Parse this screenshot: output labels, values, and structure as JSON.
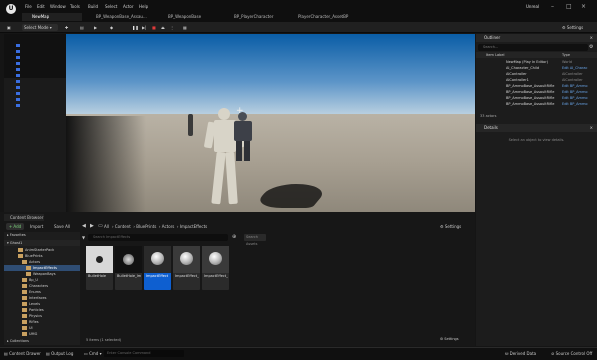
{
  "app": {
    "map_tab": "NewMap",
    "window_title": "Unreal"
  },
  "menu": [
    "File",
    "Edit",
    "Window",
    "Tools",
    "Build",
    "Select",
    "Actor",
    "Help"
  ],
  "tabs": [
    "BP_WeaponBase_Assau...",
    "BP_WeaponBase",
    "BP_PlayerCharacter",
    "PlayerCharacter_AssetBP"
  ],
  "toolbar": {
    "save_label": "",
    "mode_label": "Select Mode",
    "settings_label": "Settings"
  },
  "outliner": {
    "title": "Outliner",
    "search_placeholder": "Search...",
    "col_item": "Item Label",
    "col_type": "Type",
    "rows": [
      {
        "name": "NewMap (Play In Editor)",
        "type": "World",
        "grey": true
      },
      {
        "name": "AI_Character_Child",
        "type": "Edit AI_Charac",
        "grey": false
      },
      {
        "name": "AIController",
        "type": "AIController",
        "grey": true
      },
      {
        "name": "AIController1",
        "type": "AIController",
        "grey": true
      },
      {
        "name": "BP_AmmoBase_AssaultRifle",
        "type": "Edit BP_Ammo",
        "grey": false
      },
      {
        "name": "BP_AmmoBase_AssaultRifle",
        "type": "Edit BP_Ammo",
        "grey": false
      },
      {
        "name": "BP_AmmoBase_AssaultRifle",
        "type": "Edit BP_Ammo",
        "grey": false
      },
      {
        "name": "BP_AmmoBase_AssaultRifle",
        "type": "Edit BP_Ammo",
        "grey": false
      }
    ],
    "count": "33 actors"
  },
  "details": {
    "title": "Details",
    "empty_text": "Select an object to view details."
  },
  "content_browser": {
    "title": "Content Browser",
    "add_label": "+ Add",
    "import_label": "Import",
    "save_all_label": "Save All",
    "all_label": "All",
    "breadcrumb": [
      "Content",
      "BluePrints",
      "Actors",
      "ImpactEffects"
    ],
    "settings_label": "Settings",
    "search_placeholder": "Search ImpactEffects",
    "search_assets_placeholder": "Search Assets",
    "favorites_label": "Favorites",
    "project_label": "Ghost1",
    "collections_label": "Collections",
    "items_count": "5 items (1 selected)",
    "folders": [
      "AnimStarterPack",
      "BluePrints",
      "Actors",
      "ImpactEffects",
      "WeaponBays",
      "Bp_U",
      "Characters",
      "Enums",
      "Interfaces",
      "Levels",
      "Particles",
      "Physics",
      "Rifles",
      "UI",
      "UMG",
      "Weapons",
      "Meshs"
    ],
    "assets": [
      {
        "name": "BulletHole",
        "sub": ""
      },
      {
        "name": "BulletHole_Image",
        "sub": ""
      },
      {
        "name": "ImpactEffect",
        "sub": ""
      },
      {
        "name": "ImpactEffect_AssaultRifle",
        "sub": ""
      },
      {
        "name": "ImpactEffect_Pistol",
        "sub": ""
      }
    ]
  },
  "status": {
    "content_drawer": "Content Drawer",
    "output_log": "Output Log",
    "cmd": "Cmd",
    "console_placeholder": "Enter Console Command",
    "derived_data": "Derived Data",
    "source_control": "Source Control Off"
  },
  "colors": {
    "accent": "#2b7de0",
    "selection": "#0e5fd0"
  }
}
